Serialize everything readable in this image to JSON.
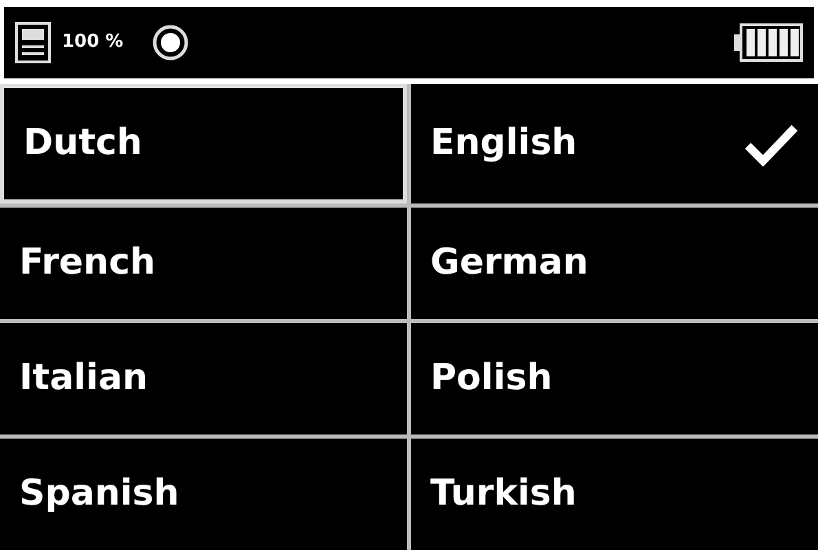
{
  "status_bar": {
    "memory": "100 %"
  },
  "languages": [
    {
      "label": "Dutch",
      "focused": true,
      "checked": false
    },
    {
      "label": "English",
      "focused": false,
      "checked": true
    },
    {
      "label": "French",
      "focused": false,
      "checked": false
    },
    {
      "label": "German",
      "focused": false,
      "checked": false
    },
    {
      "label": "Italian",
      "focused": false,
      "checked": false
    },
    {
      "label": "Polish",
      "focused": false,
      "checked": false
    },
    {
      "label": "Spanish",
      "focused": false,
      "checked": false
    },
    {
      "label": "Turkish",
      "focused": false,
      "checked": false
    }
  ]
}
